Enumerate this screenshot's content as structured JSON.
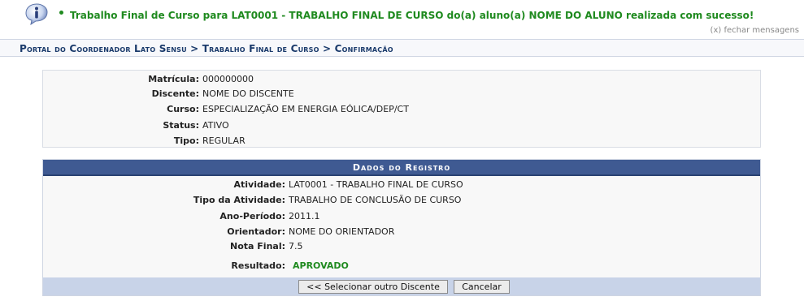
{
  "message": {
    "text": "Trabalho Final de Curso para LAT0001 - TRABALHO FINAL DE CURSO do(a) aluno(a) NOME DO ALUNO realizada com sucesso!",
    "close_label": "(x) fechar mensagens"
  },
  "breadcrumb": "Portal do Coordenador Lato Sensu > Trabalho Final de Curso > Confirmação",
  "student": {
    "matricula_label": "Matrícula:",
    "matricula": "000000000",
    "discente_label": "Discente:",
    "discente": "NOME DO DISCENTE",
    "curso_label": "Curso:",
    "curso": "ESPECIALIZAÇÃO EM ENERGIA EÓLICA/DEP/CT",
    "status_label": "Status:",
    "status": "ATIVO",
    "tipo_label": "Tipo:",
    "tipo": "REGULAR"
  },
  "registro": {
    "caption": "Dados do Registro",
    "atividade_label": "Atividade:",
    "atividade": "LAT0001 - TRABALHO FINAL DE CURSO",
    "tipo_atividade_label": "Tipo da Atividade:",
    "tipo_atividade": "TRABALHO DE CONCLUSÃO DE CURSO",
    "ano_periodo_label": "Ano-Período:",
    "ano_periodo": "2011.1",
    "orientador_label": "Orientador:",
    "orientador": "NOME DO ORIENTADOR",
    "nota_label": "Nota Final:",
    "nota": "7.5",
    "resultado_label": "Resultado:",
    "resultado": "APROVADO",
    "select_other_button": "<< Selecionar outro Discente",
    "cancel_button": "Cancelar"
  },
  "colors": {
    "success": "#1f8a1f",
    "header_blue": "#3f5a92",
    "footer_blue": "#c8d3e8"
  },
  "icons": {
    "message": "info-icon",
    "bullet": "bullet-icon"
  }
}
